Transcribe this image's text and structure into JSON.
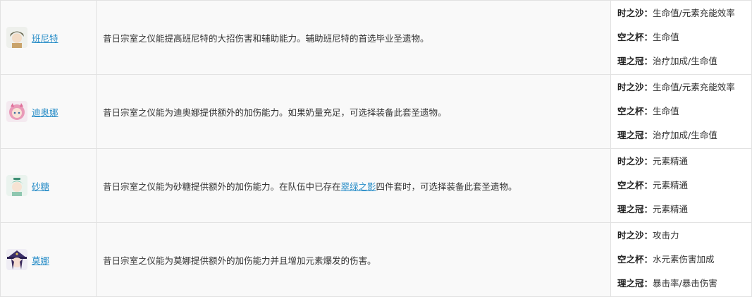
{
  "rows": [
    {
      "name": "班尼特",
      "desc": "昔日宗室之仪能提高班尼特的大招伤害和辅助能力。辅助班尼特的首选毕业圣遗物。",
      "stats": [
        {
          "key": "时之沙：",
          "val": "生命值/元素充能效率"
        },
        {
          "key": "空之杯：",
          "val": "生命值"
        },
        {
          "key": "理之冠：",
          "val": "治疗加成/生命值"
        }
      ],
      "avatar_icon": "bennett-avatar-icon"
    },
    {
      "name": "迪奥娜",
      "desc": "昔日宗室之仪能为迪奥娜提供额外的加伤能力。如果奶量充足，可选择装备此套圣遗物。",
      "stats": [
        {
          "key": "时之沙：",
          "val": "生命值/元素充能效率"
        },
        {
          "key": "空之杯：",
          "val": "生命值"
        },
        {
          "key": "理之冠：",
          "val": "治疗加成/生命值"
        }
      ],
      "avatar_icon": "diona-avatar-icon"
    },
    {
      "name": "砂糖",
      "desc_before": "昔日宗室之仪能为砂糖提供额外的加伤能力。在队伍中已存在",
      "desc_link": "翠绿之影",
      "desc_after": "四件套时，可选择装备此套圣遗物。",
      "stats": [
        {
          "key": "时之沙：",
          "val": "元素精通"
        },
        {
          "key": "空之杯：",
          "val": "元素精通"
        },
        {
          "key": "理之冠：",
          "val": "元素精通"
        }
      ],
      "avatar_icon": "sucrose-avatar-icon"
    },
    {
      "name": "莫娜",
      "desc": "昔日宗室之仪能为莫娜提供额外的加伤能力并且增加元素爆发的伤害。",
      "stats": [
        {
          "key": "时之沙：",
          "val": "攻击力"
        },
        {
          "key": "空之杯：",
          "val": "水元素伤害加成"
        },
        {
          "key": "理之冠：",
          "val": "暴击率/暴击伤害"
        }
      ],
      "avatar_icon": "mona-avatar-icon"
    }
  ]
}
